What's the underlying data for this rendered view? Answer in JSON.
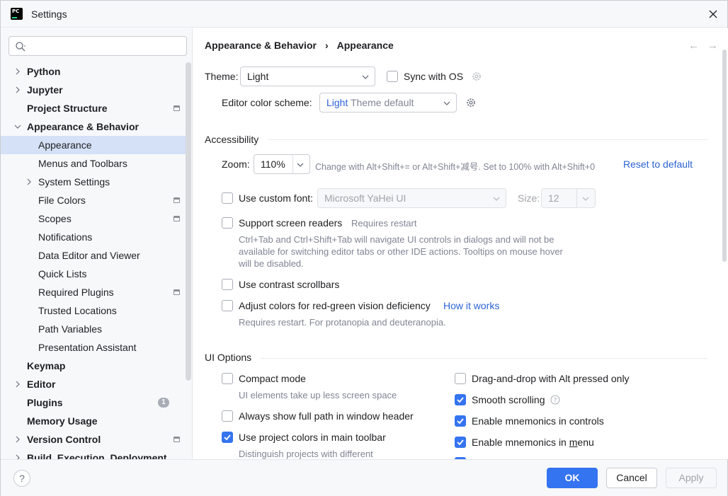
{
  "window": {
    "title": "Settings"
  },
  "search": {
    "placeholder": ""
  },
  "sidebar": {
    "items": [
      {
        "label": "Python",
        "level": 0,
        "bold": true,
        "expandable": true,
        "expanded": false
      },
      {
        "label": "Jupyter",
        "level": 0,
        "bold": true,
        "expandable": true,
        "expanded": false
      },
      {
        "label": "Project Structure",
        "level": 0,
        "bold": true,
        "project_icon": true
      },
      {
        "label": "Appearance & Behavior",
        "level": 0,
        "bold": true,
        "expandable": true,
        "expanded": true
      },
      {
        "label": "Appearance",
        "level": 1,
        "selected": true
      },
      {
        "label": "Menus and Toolbars",
        "level": 1
      },
      {
        "label": "System Settings",
        "level": 1,
        "expandable": true,
        "expanded": false
      },
      {
        "label": "File Colors",
        "level": 1,
        "project_icon": true
      },
      {
        "label": "Scopes",
        "level": 1,
        "project_icon": true
      },
      {
        "label": "Notifications",
        "level": 1
      },
      {
        "label": "Data Editor and Viewer",
        "level": 1
      },
      {
        "label": "Quick Lists",
        "level": 1
      },
      {
        "label": "Required Plugins",
        "level": 1,
        "project_icon": true
      },
      {
        "label": "Trusted Locations",
        "level": 1
      },
      {
        "label": "Path Variables",
        "level": 1
      },
      {
        "label": "Presentation Assistant",
        "level": 1
      },
      {
        "label": "Keymap",
        "level": 0,
        "bold": true
      },
      {
        "label": "Editor",
        "level": 0,
        "bold": true,
        "expandable": true,
        "expanded": false
      },
      {
        "label": "Plugins",
        "level": 0,
        "bold": true,
        "badge": "1"
      },
      {
        "label": "Memory Usage",
        "level": 0,
        "bold": true
      },
      {
        "label": "Version Control",
        "level": 0,
        "bold": true,
        "expandable": true,
        "expanded": false,
        "project_icon": true
      },
      {
        "label": "Build, Execution, Deployment",
        "level": 0,
        "bold": true,
        "expandable": true,
        "expanded": false
      }
    ]
  },
  "breadcrumb": {
    "parent": "Appearance & Behavior",
    "separator": "›",
    "current": "Appearance"
  },
  "nav": {
    "back": "←",
    "forward": "→"
  },
  "theme": {
    "label": "Theme:",
    "value": "Light",
    "sync_label": "Sync with OS",
    "sync_checked": false
  },
  "scheme": {
    "label": "Editor color scheme:",
    "value_accent": "Light",
    "value_rest": " Theme default"
  },
  "accessibility": {
    "title": "Accessibility",
    "zoom_label": "Zoom:",
    "zoom_value": "110%",
    "zoom_hint": "Change with Alt+Shift+= or Alt+Shift+减号. Set to 100% with Alt+Shift+0",
    "reset_link": "Reset to default",
    "custom_font_label": "Use custom font:",
    "custom_font_value": "Microsoft YaHei UI",
    "size_label": "Size:",
    "size_value": "12",
    "screen_readers_label": "Support screen readers",
    "screen_readers_hint": "Requires restart",
    "screen_readers_desc_1": "Ctrl+Tab and Ctrl+Shift+Tab will navigate UI controls in dialogs and will not be",
    "screen_readers_desc_2": "available for switching editor tabs or other IDE actions. Tooltips on mouse hover",
    "screen_readers_desc_3": "will be disabled.",
    "contrast_scrollbars_label": "Use contrast scrollbars",
    "color_deficiency_label": "Adjust colors for red-green vision deficiency",
    "how_it_works_link": "How it works",
    "color_deficiency_hint": "Requires restart. For protanopia and deuteranopia."
  },
  "ui_options": {
    "title": "UI Options",
    "compact_mode_label": "Compact mode",
    "compact_mode_hint": "UI elements take up less screen space",
    "full_path_label": "Always show full path in window header",
    "project_colors_label": "Use project colors in main toolbar",
    "project_colors_hint": "Distinguish projects with different",
    "drag_drop_label": "Drag-and-drop with Alt pressed only",
    "smooth_scrolling_label": "Smooth scrolling",
    "mnemonics_controls_label": "Enable mnemonics in controls",
    "mnemonics_menu_prefix": "Enable mnemonics in ",
    "mnemonics_menu_underlined": "m",
    "mnemonics_menu_suffix": "enu"
  },
  "footer": {
    "help": "?",
    "ok": "OK",
    "cancel": "Cancel",
    "apply": "Apply"
  },
  "colors": {
    "accent": "#3574f0",
    "link": "#2b63d5",
    "selection": "#d5e1f6"
  }
}
